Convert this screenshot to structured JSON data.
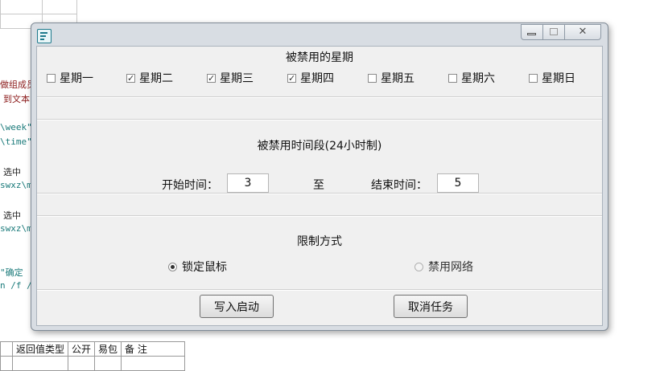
{
  "background": {
    "code_lines": [
      "做组成员",
      "到文本",
      "\\week\"",
      "\\time\"",
      "选中",
      "swxz\\mo",
      "选中",
      "swxz\\mo",
      "\"确定",
      "n /f /s"
    ],
    "table_headers": [
      "返回值类型",
      "公开",
      "易包",
      "备 注"
    ]
  },
  "window": {
    "icon": "app-logo-icon",
    "controls": {
      "close_glyph": "✕"
    },
    "weekdays_section": {
      "title": "被禁用的星期",
      "days": [
        {
          "label": "星期一",
          "checked": false
        },
        {
          "label": "星期二",
          "checked": true
        },
        {
          "label": "星期三",
          "checked": true
        },
        {
          "label": "星期四",
          "checked": true
        },
        {
          "label": "星期五",
          "checked": false
        },
        {
          "label": "星期六",
          "checked": false
        },
        {
          "label": "星期日",
          "checked": false
        }
      ]
    },
    "time_section": {
      "title": "被禁用时间段(24小时制)",
      "start_label": "开始时间：",
      "start_value": "3",
      "to_label": "至",
      "end_label": "结束时间：",
      "end_value": "5"
    },
    "method_section": {
      "title": "限制方式",
      "options": [
        {
          "label": "锁定鼠标",
          "selected": true
        },
        {
          "label": "禁用网络",
          "selected": false
        }
      ]
    },
    "buttons": {
      "write_start": "写入启动",
      "cancel_task": "取消任务"
    }
  }
}
